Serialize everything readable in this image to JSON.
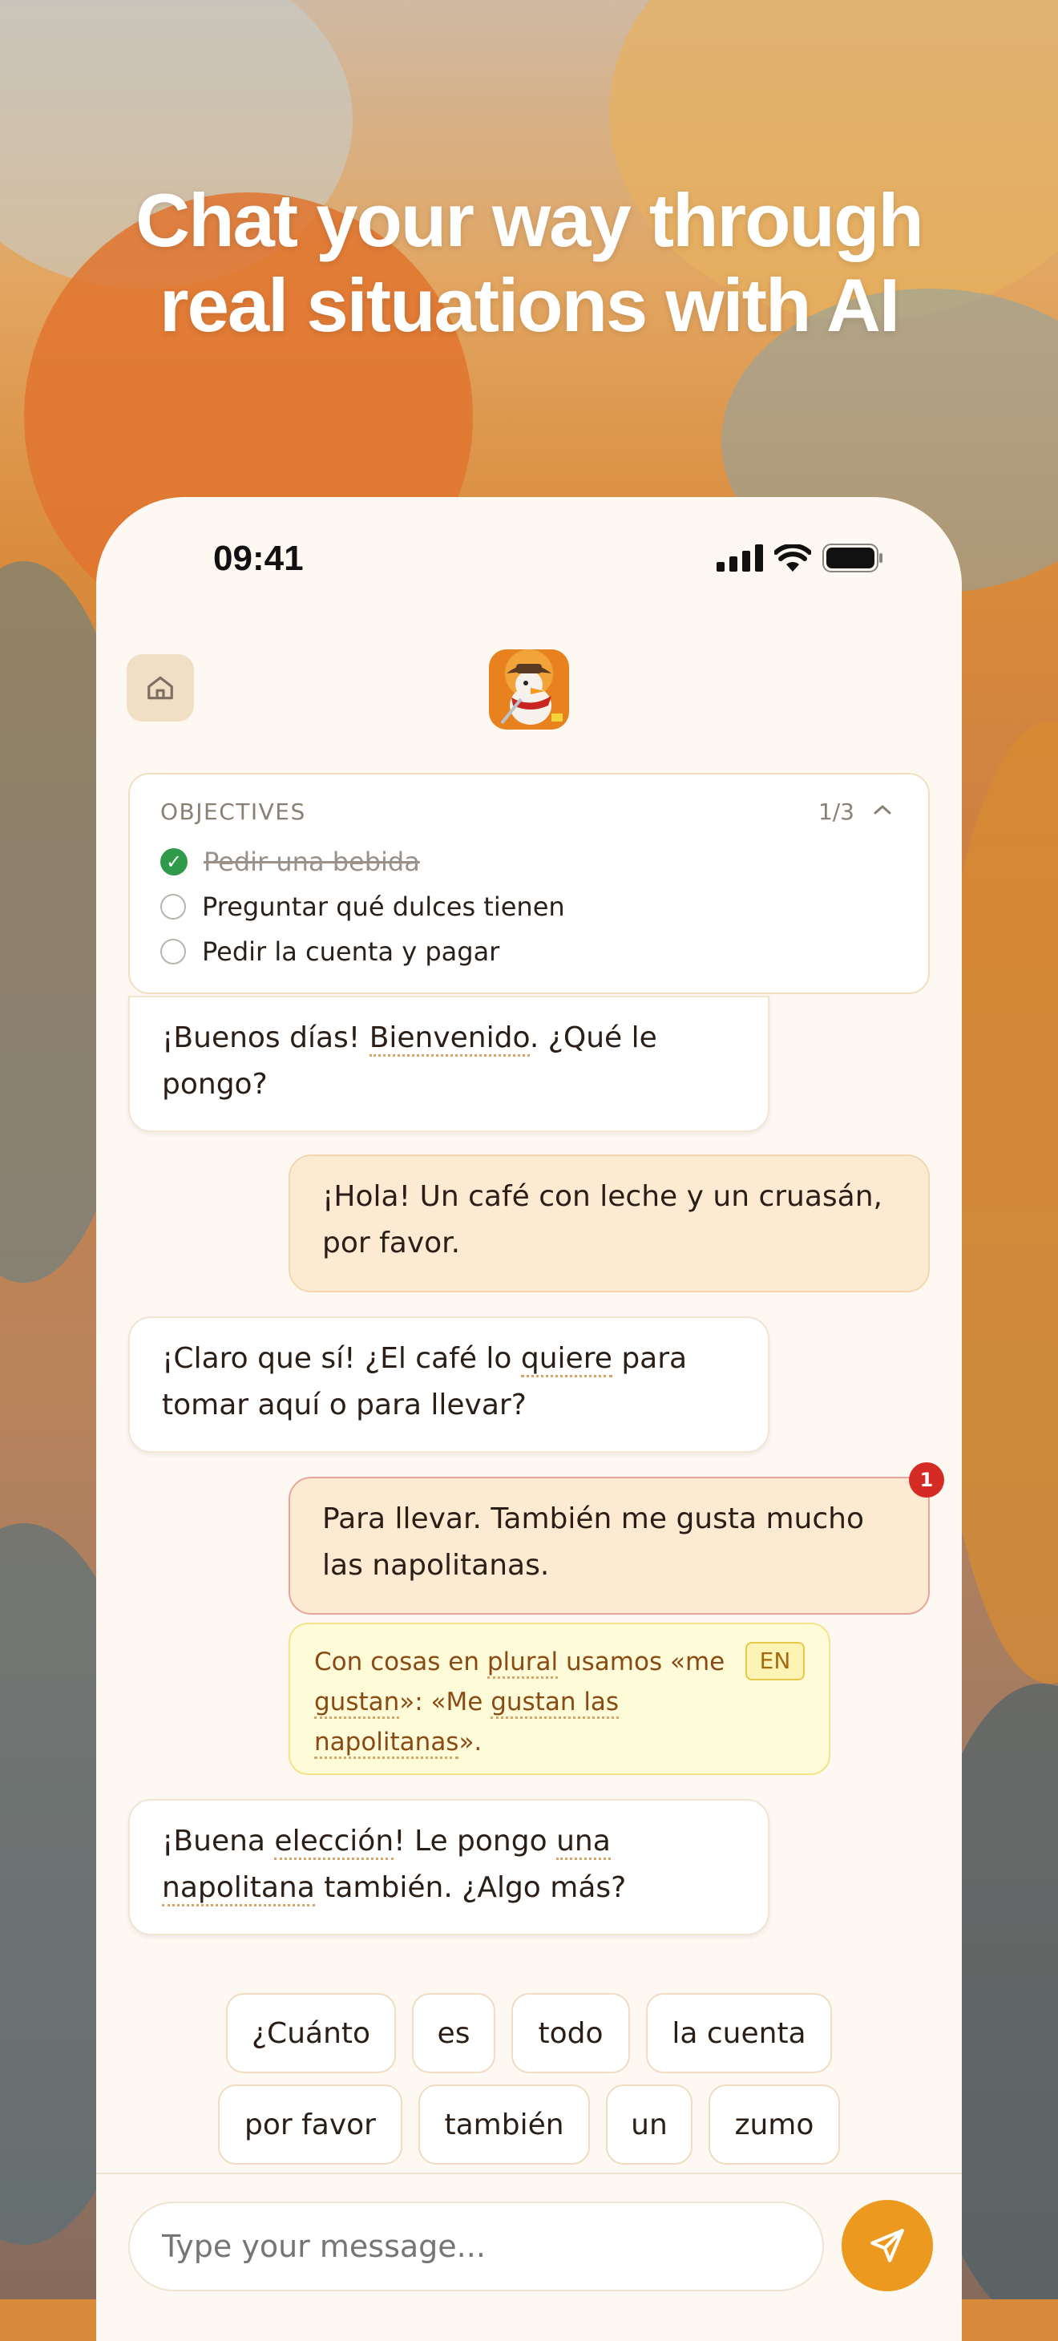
{
  "headline": {
    "line1": "Chat your way through",
    "line2": "real situations with AI"
  },
  "status_bar": {
    "time": "09:41"
  },
  "objectives": {
    "title": "OBJECTIVES",
    "count": "1/3",
    "items": [
      {
        "label": "Pedir una bebida",
        "done": true
      },
      {
        "label": "Preguntar qué dulces tienen",
        "done": false
      },
      {
        "label": "Pedir la cuenta y pagar",
        "done": false
      }
    ]
  },
  "messages": {
    "m1": {
      "a": "¡Buenos días! ",
      "b": "Bienvenido",
      "c": ". ¿Qué le pongo?"
    },
    "m2": {
      "text": "¡Hola! Un café con leche y un cruasán, por favor."
    },
    "m3": {
      "a": "¡Claro que sí! ¿El café lo ",
      "b": "quiere",
      "c": " para tomar aquí o para llevar?"
    },
    "m4": {
      "text": "Para llevar. También me gusta mucho las napolitanas.",
      "badge": "1"
    },
    "correction": {
      "a": "Con cosas en ",
      "b": "plural",
      "c": " usamos «me ",
      "d": "gustan",
      "e": "»: «Me ",
      "f": "gustan las napolitanas",
      "g": "».",
      "lang_tag": "EN"
    },
    "m5": {
      "a": "¡Buena ",
      "b": "elección",
      "c": "! Le pongo ",
      "d": "una",
      "e": " ",
      "f": "napolitana",
      "g": " también. ¿Algo más?"
    }
  },
  "suggestions": {
    "row1": [
      "¿Cuánto",
      "es",
      "todo",
      "la cuenta"
    ],
    "row2": [
      "por favor",
      "también",
      "un",
      "zumo"
    ]
  },
  "composer": {
    "placeholder": "Type your message..."
  }
}
